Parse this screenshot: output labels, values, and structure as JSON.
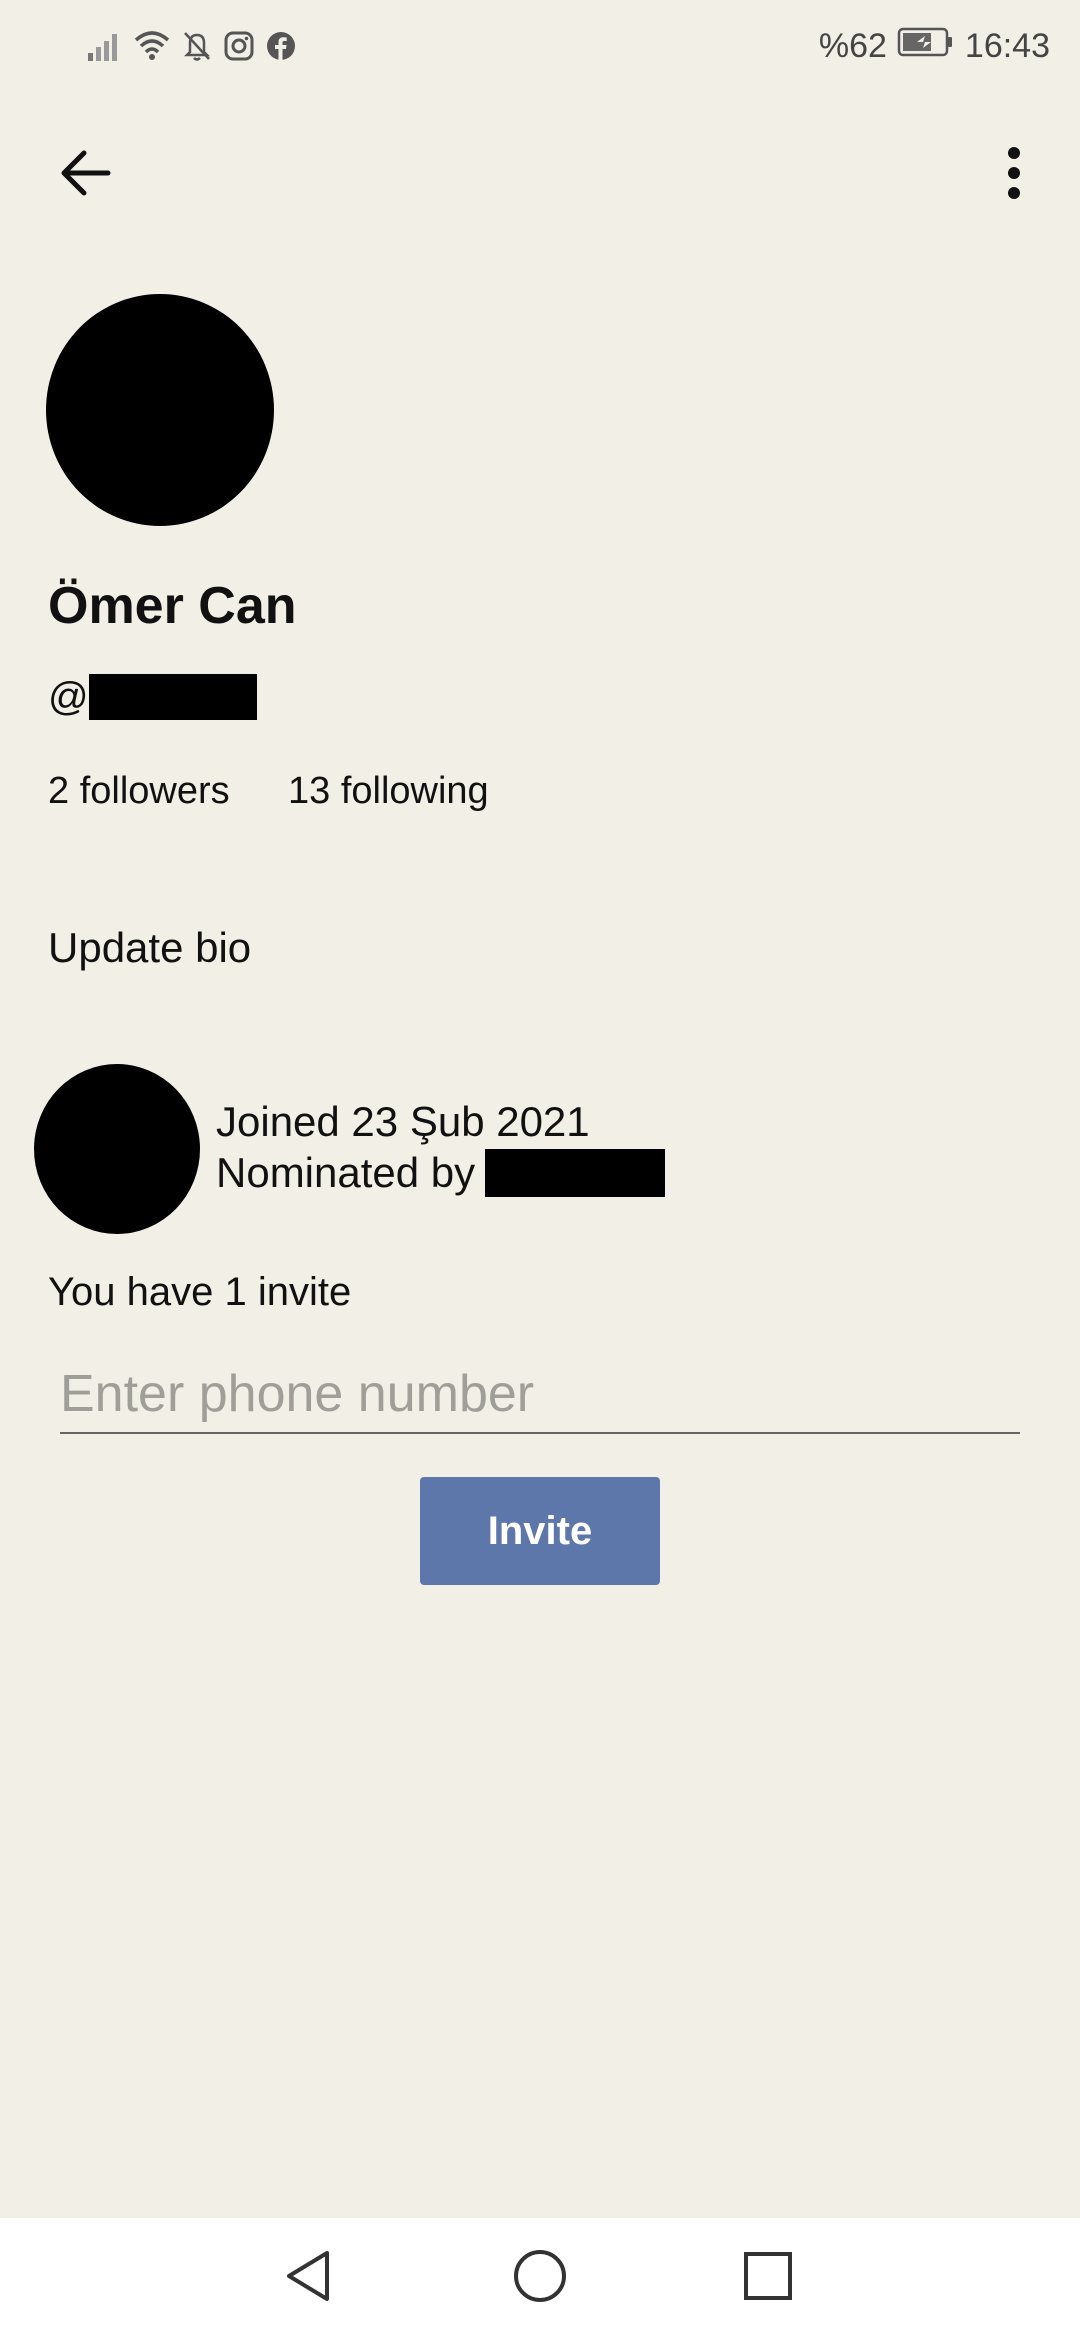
{
  "status_bar": {
    "battery": "%62",
    "time": "16:43",
    "icons": [
      "signal-icon",
      "wifi-icon",
      "notifications-off-icon",
      "instagram-icon",
      "facebook-icon",
      "battery-icon"
    ]
  },
  "toolbar": {
    "back_icon": "back-arrow-icon",
    "more_icon": "more-vertical-icon"
  },
  "profile": {
    "name": "Ömer Can",
    "username_prefix": "@",
    "followers": "2 followers",
    "following": "13 following",
    "update_bio": "Update bio"
  },
  "joined": {
    "joined_text": "Joined 23 Şub 2021",
    "nominated_by": "Nominated by"
  },
  "invite": {
    "count_text": "You have 1 invite",
    "phone_placeholder": "Enter phone number",
    "button_label": "Invite",
    "button_color": "#5d77aa"
  },
  "nav": {
    "icons": [
      "back-nav-icon",
      "home-nav-icon",
      "recents-nav-icon"
    ]
  },
  "colors": {
    "background": "#f1efe6",
    "nav_background": "#ffffff"
  }
}
